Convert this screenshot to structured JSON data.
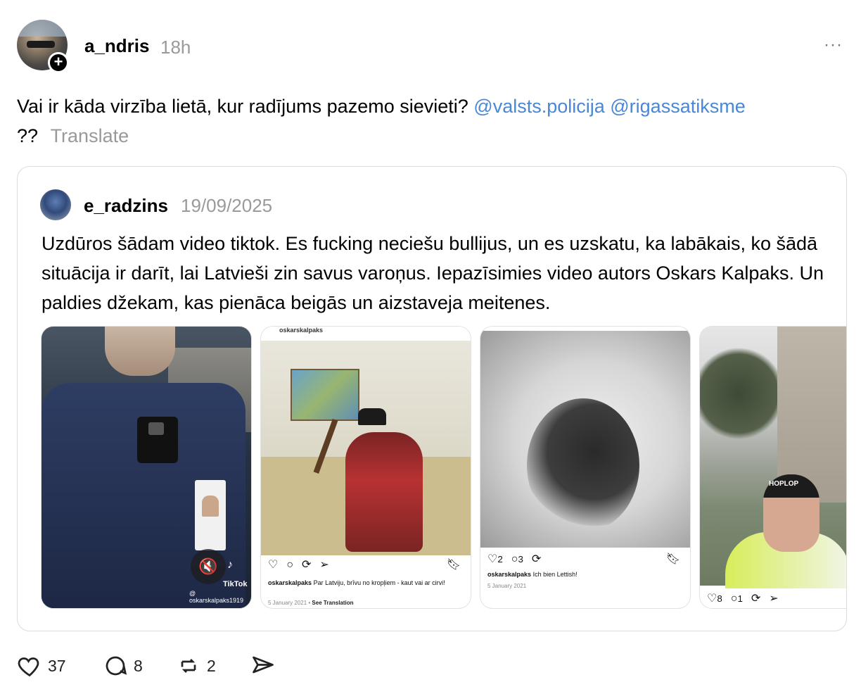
{
  "post": {
    "username": "a_ndris",
    "time": "18h",
    "more": "···",
    "text": "Vai ir kāda virzība lietā, kur radījums pazemo sievieti?",
    "mention1": "@valsts.policija",
    "mention2": "@rigassatiksme",
    "suffix": "??",
    "translate": "Translate"
  },
  "quote": {
    "username": "e_radzins",
    "date": "19/09/2025",
    "text": "Uzdūros šādam video tiktok. Es fucking neciešu bullijus, un es uzskatu, ka labākais, ko šādā situācija ir darīt, lai Latvieši zin savus varoņus. Iepazīsimies video autors Oskars Kalpaks. Un paldies džekam, kas pienāca beigās un aizstaveja meitenes."
  },
  "media": {
    "tiktok": {
      "logo": "♪",
      "label": "TikTok",
      "handle": "@ oskarskalpaks1919",
      "mute": "🔇"
    },
    "ig2": {
      "account": "oskarskalpaks",
      "caption_user": "oskarskalpaks",
      "caption": "Par Latviju, brīvu no kropļiem - kaut vai ar cirvi!",
      "date": "5 January 2021",
      "see_translation": "See Translation"
    },
    "ig3": {
      "likes": "2",
      "comments": "3",
      "caption_user": "oskarskalpaks",
      "caption": "Ich bien Lettish!",
      "date": "5 January 2021"
    },
    "ig4": {
      "likes": "8",
      "comments": "1",
      "hat_text": "HOPLOP"
    }
  },
  "footer": {
    "likes": "37",
    "replies": "8",
    "reposts": "2"
  },
  "icons": [
    "plus-icon",
    "more-icon",
    "heart-icon",
    "comment-icon",
    "repost-icon",
    "share-icon",
    "mute-icon",
    "tiktok-icon",
    "bookmark-icon"
  ],
  "colors": {
    "mention": "#4a87d4",
    "muted_text": "#9a9a9a",
    "border": "#dcdcdc"
  }
}
